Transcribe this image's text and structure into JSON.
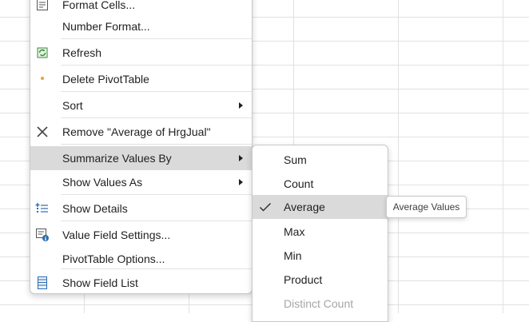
{
  "context_menu": {
    "items": [
      {
        "label": "Format Cells...",
        "icon": "format-cells-icon"
      },
      {
        "label": "Number Format...",
        "icon": ""
      },
      {
        "label": "Refresh",
        "icon": "refresh-icon"
      },
      {
        "label": "Delete PivotTable",
        "icon": "delete-dot-icon"
      },
      {
        "label": "Sort",
        "icon": "",
        "has_submenu": true
      },
      {
        "label": "Remove \"Average of HrgJual\"",
        "icon": "remove-x-icon"
      },
      {
        "label": "Summarize Values By",
        "icon": "",
        "has_submenu": true,
        "highlighted": true
      },
      {
        "label": "Show Values As",
        "icon": "",
        "has_submenu": true
      },
      {
        "label": "Show Details",
        "icon": "show-details-icon"
      },
      {
        "label": "Value Field Settings...",
        "icon": "value-field-settings-icon"
      },
      {
        "label": "PivotTable Options...",
        "icon": ""
      },
      {
        "label": "Show Field List",
        "icon": "field-list-icon"
      }
    ]
  },
  "submenu": {
    "items": [
      {
        "label": "Sum"
      },
      {
        "label": "Count"
      },
      {
        "label": "Average",
        "checked": true,
        "highlighted": true
      },
      {
        "label": "Max"
      },
      {
        "label": "Min"
      },
      {
        "label": "Product"
      },
      {
        "label": "Distinct Count",
        "disabled": true
      }
    ]
  },
  "tooltip": {
    "text": "Average Values"
  },
  "colors": {
    "highlight": "#dadada",
    "icon_blue": "#2b6cb0",
    "icon_green": "#3a8a3a",
    "icon_orange": "#f0a030",
    "disabled_text": "#a6a6a6"
  }
}
